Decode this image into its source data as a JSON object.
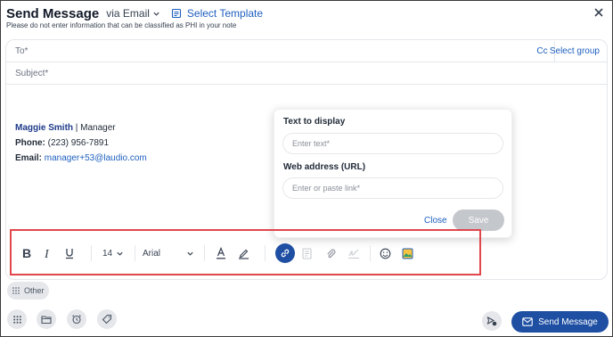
{
  "header": {
    "title": "Send Message",
    "via_label": "via Email",
    "template_label": "Select Template",
    "note": "Please do not enter information that can be classified as PHI in your note"
  },
  "fields": {
    "to_label": "To*",
    "cc_label": "Cc",
    "select_group_label": "Select group",
    "subject_label": "Subject*"
  },
  "signature": {
    "name": "Maggie Smith",
    "separator_role": " | Manager",
    "phone_label": "Phone:",
    "phone": " (223) 956-7891",
    "email_label": "Email:",
    "email": " manager+53@laudio.com"
  },
  "link_popup": {
    "text_label": "Text to display",
    "text_placeholder": "Enter text*",
    "url_label": "Web address (URL)",
    "url_placeholder": "Enter or paste link*",
    "close_label": "Close",
    "save_label": "Save"
  },
  "toolbar": {
    "font_size": "14",
    "font_family": "Arial",
    "icons": [
      "bold-icon",
      "italic-icon",
      "underline-icon",
      "font-color-icon",
      "highlight-icon",
      "link-icon",
      "document-icon",
      "attachment-icon",
      "signature-icon",
      "emoji-icon",
      "image-icon"
    ]
  },
  "other_label": "Other",
  "footer": {
    "send_label": "Send Message"
  },
  "colors": {
    "accent": "#1e4fa3",
    "link": "#1e5fbf",
    "highlight_border": "#e0474c",
    "disabled": "#c4c7cc"
  }
}
